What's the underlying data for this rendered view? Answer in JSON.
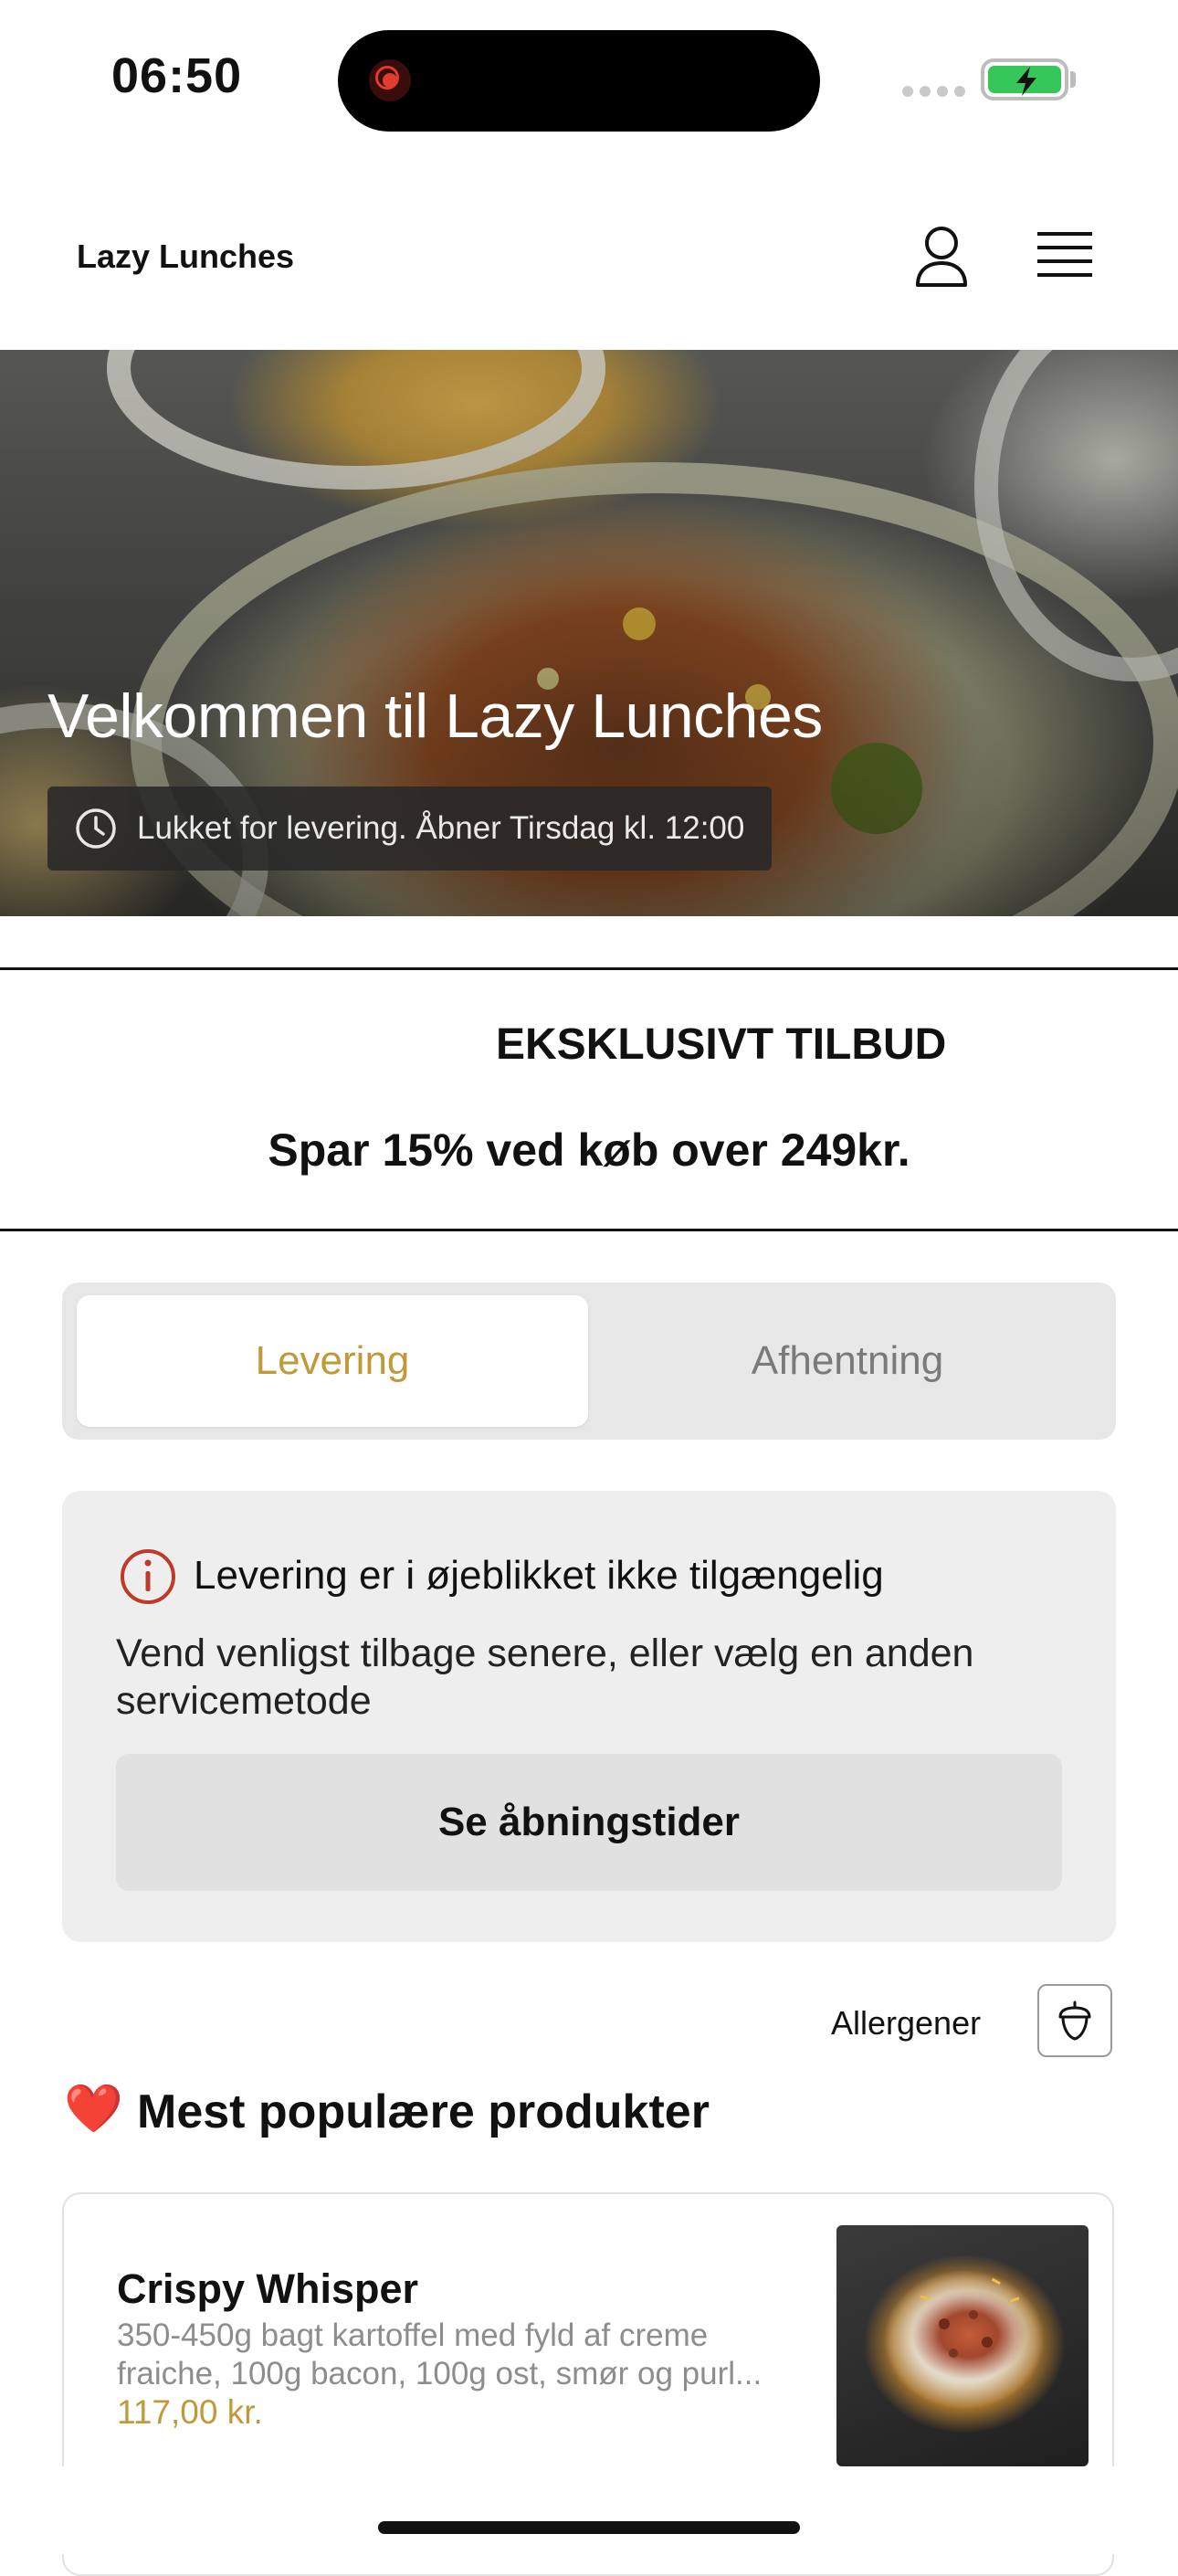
{
  "status_bar": {
    "time": "06:50",
    "battery_color": "#35c759",
    "recording_color": "#e23b32"
  },
  "header": {
    "brand": "Lazy Lunches",
    "account_icon": "user-icon",
    "menu_icon": "hamburger-menu-icon"
  },
  "hero": {
    "title": "Velkommen til Lazy Lunches",
    "status_text": "Lukket for levering. Åbner Tirsdag kl. 12:00",
    "status_icon": "clock-icon"
  },
  "offer": {
    "title": "EKSKLUSIVT TILBUD",
    "subtitle": "Spar 15% ved køb over 249kr."
  },
  "service_tabs": {
    "options": [
      {
        "label": "Levering",
        "selected": true
      },
      {
        "label": "Afhentning",
        "selected": false
      }
    ],
    "accent_color": "#c09a3a"
  },
  "notice": {
    "icon": "info-alert-icon",
    "title": "Levering er i øjeblikket ikke tilgængelig",
    "body": "Vend venligst tilbage senere, eller vælg en anden servicemetode",
    "button_label": "Se åbningstider",
    "icon_color": "#c0392b"
  },
  "allergens": {
    "label": "Allergener",
    "icon": "acorn-icon"
  },
  "popular": {
    "emoji": "❤️",
    "title": "Mest populære produkter",
    "products": [
      {
        "name": "Crispy Whisper",
        "description": "350-450g bagt kartoffel med fyld af creme fraiche, 100g bacon, 100g ost, smør og purl...",
        "price": "117,00 kr."
      }
    ]
  }
}
